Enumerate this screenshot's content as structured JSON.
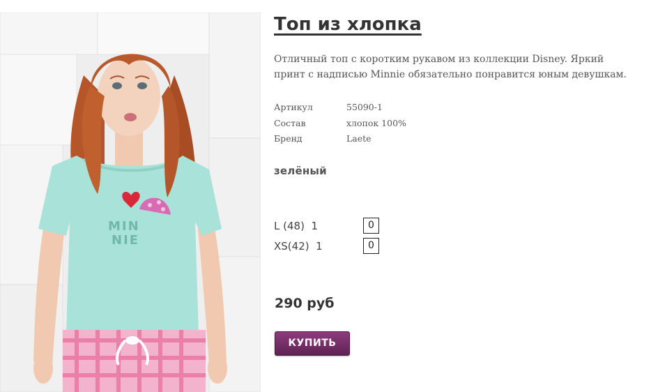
{
  "product": {
    "title": "Топ из хлопка",
    "description": "Отличный топ с коротким рукавом из коллекции Disney. Яркий принт с надписью Minnie обязательно понравится юным девушкам.",
    "specs": [
      {
        "key": "Артикул",
        "value": "55090-1"
      },
      {
        "key": "Состав",
        "value": "хлопок 100%"
      },
      {
        "key": "Бренд",
        "value": "Laete"
      }
    ],
    "color": "зелёный",
    "sizes": [
      {
        "label": "L (48)  1",
        "qty": "0"
      },
      {
        "label": "XS(42)  1",
        "qty": "0"
      }
    ],
    "price": "290 руб",
    "buy_label": "КУПИТЬ",
    "print_text": "MIN NIE"
  },
  "colors": {
    "button": "#6e2a62",
    "shirt": "#a9e2d8",
    "hair": "#b5562a"
  }
}
